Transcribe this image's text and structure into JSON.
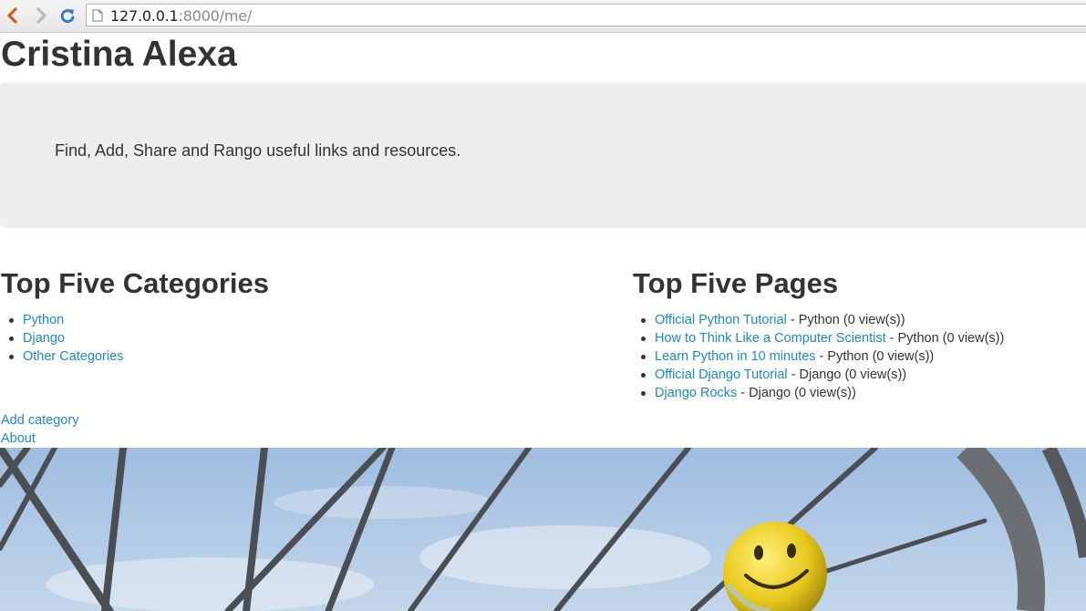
{
  "browser": {
    "url_host": "127.0.0.1",
    "url_rest": ":8000/me/",
    "icons": {
      "back": "back-arrow-icon",
      "forward": "forward-arrow-icon",
      "reload": "reload-icon",
      "page": "page-icon"
    }
  },
  "header": {
    "title": "Cristina Alexa"
  },
  "jumbotron": {
    "tagline": "Find, Add, Share and Rango useful links and resources."
  },
  "categories": {
    "heading": "Top Five Categories",
    "items": [
      {
        "label": "Python"
      },
      {
        "label": "Django"
      },
      {
        "label": "Other Categories"
      }
    ]
  },
  "pages": {
    "heading": "Top Five Pages",
    "items": [
      {
        "title": "Official Python Tutorial",
        "meta": " - Python (0 view(s))"
      },
      {
        "title": "How to Think Like a Computer Scientist",
        "meta": " - Python (0 view(s))"
      },
      {
        "title": "Learn Python in 10 minutes",
        "meta": " - Python (0 view(s))"
      },
      {
        "title": "Official Django Tutorial",
        "meta": " - Django (0 view(s))"
      },
      {
        "title": "Django Rocks",
        "meta": " - Django (0 view(s))"
      }
    ]
  },
  "footer": {
    "add_category": "Add category",
    "about": "About"
  },
  "colors": {
    "link": "#1a8ac8",
    "text": "#333333",
    "jumbotron_bg": "#eeeeee",
    "sky": "#a9c3de"
  }
}
